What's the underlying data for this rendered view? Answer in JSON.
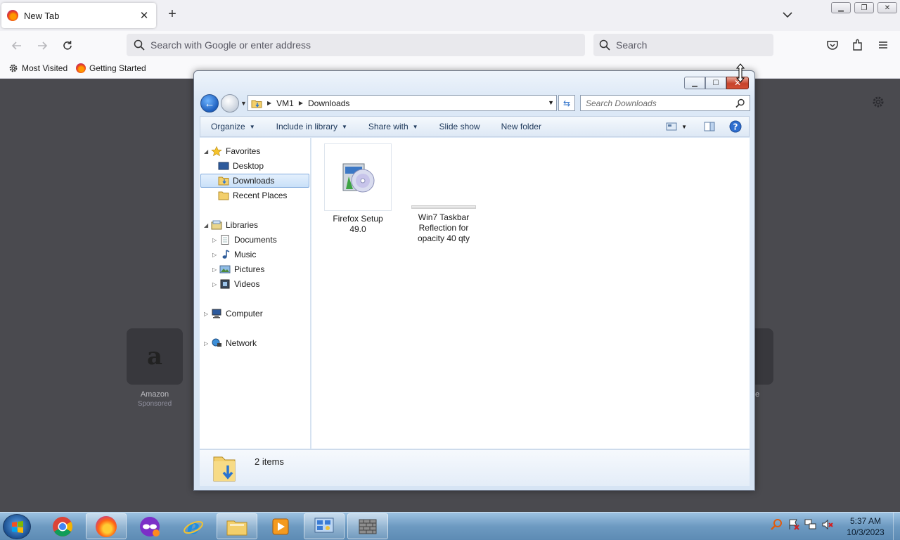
{
  "browser": {
    "tab_title": "New Tab",
    "tab_close": "✕",
    "new_tab_symbol": "+",
    "url_placeholder": "Search with Google or enter address",
    "search_placeholder": "Search",
    "bookmarks": [
      {
        "label": "Most Visited",
        "icon": "gear-icon"
      },
      {
        "label": "Getting Started",
        "icon": "firefox-icon"
      }
    ]
  },
  "new_tab_page": {
    "top_sites": [
      {
        "name": "Amazon",
        "sponsored": "Sponsored",
        "glyph": "a"
      }
    ],
    "partial_label": "e"
  },
  "explorer": {
    "breadcrumb": [
      "VM1",
      "Downloads"
    ],
    "search_placeholder": "Search Downloads",
    "commands": [
      "Organize",
      "Include in library",
      "Share with",
      "Slide show",
      "New folder"
    ],
    "nav": {
      "favorites": "Favorites",
      "favorite_items": [
        "Desktop",
        "Downloads",
        "Recent Places"
      ],
      "libraries": "Libraries",
      "library_items": [
        "Documents",
        "Music",
        "Pictures",
        "Videos"
      ],
      "computer": "Computer",
      "network": "Network"
    },
    "files": [
      {
        "name": "Firefox Setup 49.0",
        "icon": "installer-cd-icon"
      },
      {
        "name_lines": [
          "Win7 Taskbar",
          "Reflection for",
          "opacity 40 qty"
        ],
        "icon": "image-thumbnail-icon"
      }
    ],
    "status": "2 items"
  },
  "taskbar": {
    "apps": [
      "chrome-icon",
      "firefox-icon",
      "incognito-mask-icon",
      "internet-explorer-icon",
      "windows-explorer-icon",
      "media-player-icon",
      "control-panel-icon",
      "firewall-icon"
    ],
    "time": "5:37 AM",
    "date": "10/3/2023"
  },
  "colors": {
    "ntp_background": "#4a4a4f",
    "selection": "#c9e0f8",
    "taskbar": "#6d9ac1"
  }
}
